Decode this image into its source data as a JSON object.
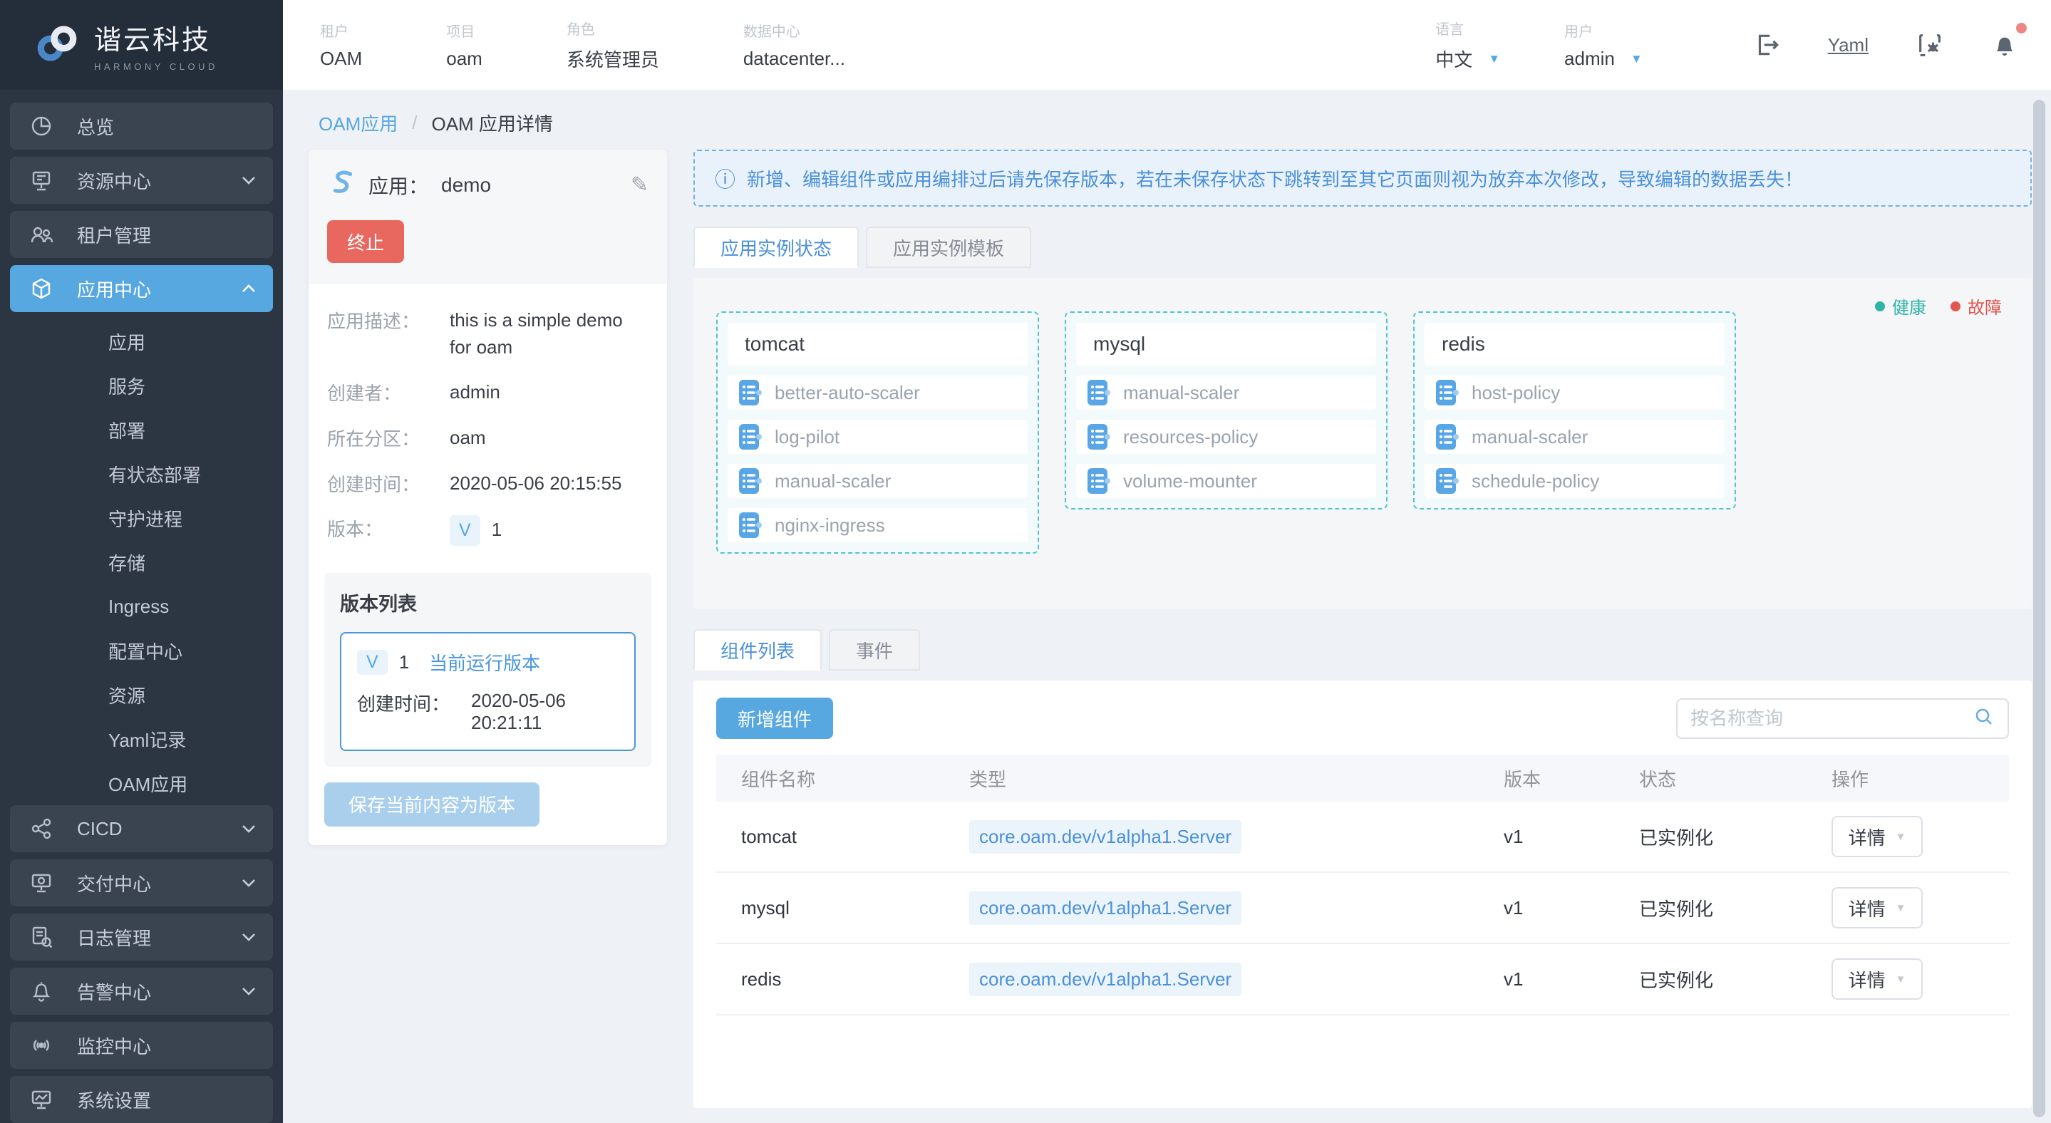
{
  "colors": {
    "accent": "#57a7e0",
    "danger": "#e8685f",
    "link_blue": "#4a90d9",
    "healthy": "#2eb4a5",
    "fault": "#e25650",
    "sidebar_bg": "#2c3542"
  },
  "logo": {
    "title": "谐云科技",
    "subtitle": "HARMONY CLOUD"
  },
  "header": {
    "context": [
      {
        "label": "租户",
        "value": "OAM"
      },
      {
        "label": "项目",
        "value": "oam"
      },
      {
        "label": "角色",
        "value": "系统管理员"
      },
      {
        "label": "数据中心",
        "value": "datacenter..."
      }
    ],
    "language": {
      "label": "语言",
      "value": "中文"
    },
    "user": {
      "label": "用户",
      "value": "admin"
    },
    "yaml_link": "Yaml"
  },
  "sidebar": {
    "items": [
      {
        "label": "总览"
      },
      {
        "label": "资源中心",
        "expandable": true
      },
      {
        "label": "租户管理"
      },
      {
        "label": "应用中心",
        "expandable": true,
        "expanded": true,
        "active": true,
        "children": [
          {
            "label": "应用"
          },
          {
            "label": "服务"
          },
          {
            "label": "部署"
          },
          {
            "label": "有状态部署"
          },
          {
            "label": "守护进程"
          },
          {
            "label": "存储"
          },
          {
            "label": "Ingress"
          },
          {
            "label": "配置中心"
          },
          {
            "label": "资源"
          },
          {
            "label": "Yaml记录"
          },
          {
            "label": "OAM应用"
          }
        ]
      },
      {
        "label": "CICD",
        "expandable": true
      },
      {
        "label": "交付中心",
        "expandable": true
      },
      {
        "label": "日志管理",
        "expandable": true
      },
      {
        "label": "告警中心",
        "expandable": true
      },
      {
        "label": "监控中心"
      },
      {
        "label": "系统设置"
      }
    ]
  },
  "breadcrumb": {
    "link": "OAM应用",
    "separator": "/",
    "current": "OAM 应用详情"
  },
  "app_card": {
    "app_label": "应用：",
    "app_name": "demo",
    "terminate_label": "终止",
    "fields": [
      {
        "label": "应用描述：",
        "value": "this is a simple demo for oam"
      },
      {
        "label": "创建者：",
        "value": "admin"
      },
      {
        "label": "所在分区：",
        "value": "oam"
      },
      {
        "label": "创建时间：",
        "value": "2020-05-06 20:15:55"
      }
    ],
    "version_label": "版本：",
    "version_badge": "V",
    "version_value": "1",
    "version_list": {
      "title": "版本列表",
      "badge": "V",
      "number": "1",
      "tag": "当前运行版本",
      "created_label": "创建时间：",
      "created_value": "2020-05-06 20:21:11"
    },
    "save_button": "保存当前内容为版本"
  },
  "main": {
    "alert_text": "新增、编辑组件或应用编排过后请先保存版本，若在未保存状态下跳转到至其它页面则视为放弃本次修改，导致编辑的数据丢失！",
    "tabs1": [
      {
        "label": "应用实例状态",
        "active": true
      },
      {
        "label": "应用实例模板",
        "active": false
      }
    ],
    "legend": [
      {
        "label": "健康",
        "color": "#2eb4a5"
      },
      {
        "label": "故障",
        "color": "#e25650"
      }
    ],
    "instances": [
      {
        "name": "tomcat",
        "traits": [
          "better-auto-scaler",
          "log-pilot",
          "manual-scaler",
          "nginx-ingress"
        ]
      },
      {
        "name": "mysql",
        "traits": [
          "manual-scaler",
          "resources-policy",
          "volume-mounter"
        ]
      },
      {
        "name": "redis",
        "traits": [
          "host-policy",
          "manual-scaler",
          "schedule-policy"
        ]
      }
    ],
    "tabs2": [
      {
        "label": "组件列表",
        "active": true
      },
      {
        "label": "事件",
        "active": false
      }
    ],
    "add_button": "新增组件",
    "search_placeholder": "按名称查询",
    "table": {
      "headers": [
        "组件名称",
        "类型",
        "版本",
        "状态",
        "操作"
      ],
      "rows": [
        {
          "name": "tomcat",
          "type": "core.oam.dev/v1alpha1.Server",
          "version": "v1",
          "status": "已实例化",
          "action": "详情"
        },
        {
          "name": "mysql",
          "type": "core.oam.dev/v1alpha1.Server",
          "version": "v1",
          "status": "已实例化",
          "action": "详情"
        },
        {
          "name": "redis",
          "type": "core.oam.dev/v1alpha1.Server",
          "version": "v1",
          "status": "已实例化",
          "action": "详情"
        }
      ]
    }
  }
}
